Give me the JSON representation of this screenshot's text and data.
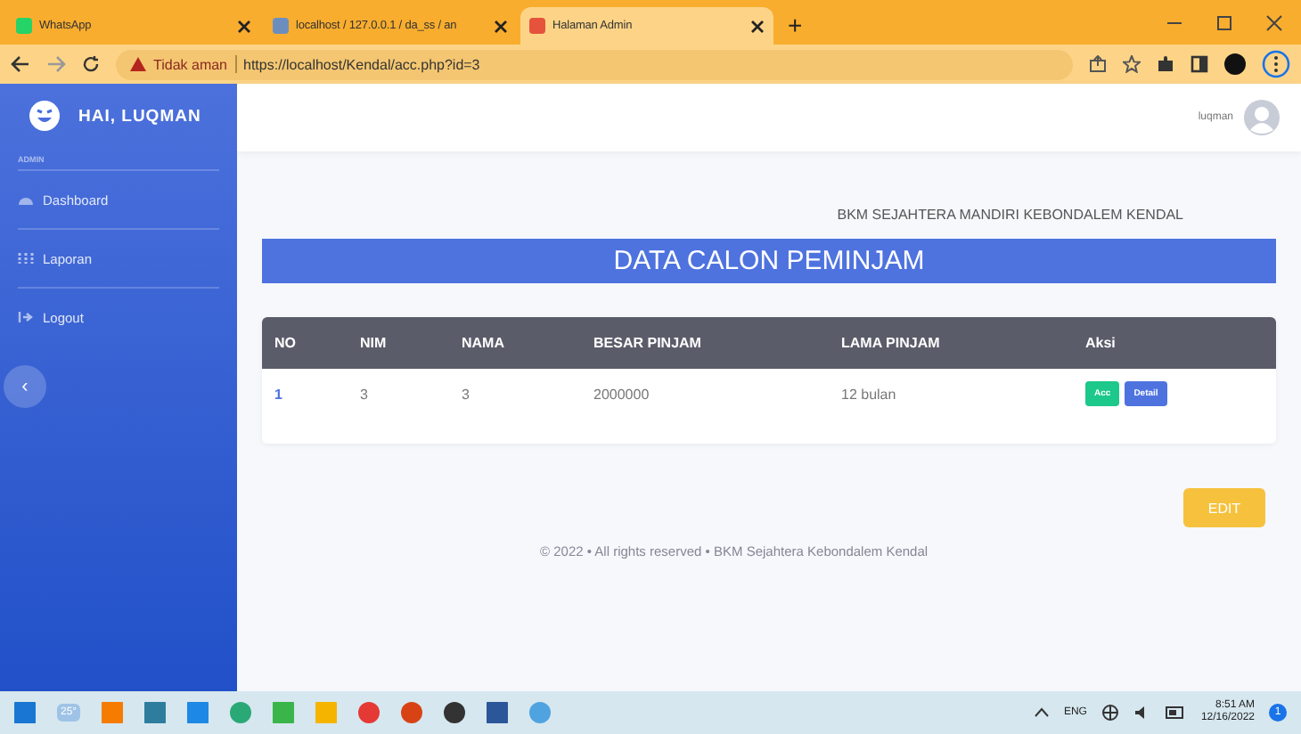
{
  "browser": {
    "tabs": [
      {
        "title": "WhatsApp",
        "selected": false
      },
      {
        "title": "localhost / 127.0.0.1 / da_ss / an",
        "selected": false
      },
      {
        "title": "Halaman Admin",
        "selected": true
      }
    ],
    "new_tab": "+",
    "security": "Tidak aman",
    "url": "https://localhost/Kendal/acc.php?id=3"
  },
  "sidebar": {
    "brand": "HAI, LUQMAN",
    "section": "ADMIN",
    "items": [
      {
        "label": "Dashboard"
      },
      {
        "label": "Laporan"
      },
      {
        "label": "Logout"
      }
    ],
    "collapse": "‹"
  },
  "topbar": {
    "user": "luqman"
  },
  "page": {
    "subtitle": "BKM SEJAHTERA MANDIRI KEBONDALEM KENDAL",
    "title": "DATA CALON PEMINJAM",
    "table": {
      "columns": [
        "NO",
        "NIM",
        "NAMA",
        "BESAR PINJAM",
        "LAMA PINJAM",
        "Aksi"
      ],
      "rows": [
        {
          "cells": [
            "1",
            "3",
            "3",
            "2000000",
            "12 bulan"
          ],
          "actions": [
            "Acc",
            "Detail"
          ]
        }
      ]
    },
    "edit_button": "EDIT",
    "footer": "© 2022 • All rights reserved • BKM Sejahtera Kebondalem Kendal"
  },
  "taskbar": {
    "weather": "25°",
    "language": "ENG",
    "time": "8:51 AM",
    "date": "12/16/2022",
    "notifications": "1"
  }
}
